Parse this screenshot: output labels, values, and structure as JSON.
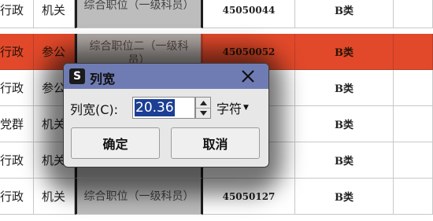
{
  "sheet": {
    "rows": [
      {
        "c1": "行政",
        "c2": "机关",
        "c3": "综合职位（一级科员）",
        "c4": "45050044",
        "c5": "B类",
        "selected": false
      },
      {
        "c1": "行政",
        "c2": "参公",
        "c3": "综合职位二（一级科员）",
        "c4": "45050052",
        "c5": "B类",
        "selected": true
      },
      {
        "c1": "行政",
        "c2": "参公",
        "c3": "",
        "c4": "",
        "c5": "B类",
        "selected": false
      },
      {
        "c1": "党群",
        "c2": "机关",
        "c3": "",
        "c4": "",
        "c5": "B类",
        "selected": false
      },
      {
        "c1": "行政",
        "c2": "机关",
        "c3": "",
        "c4": "",
        "c5": "B类",
        "selected": false
      },
      {
        "c1": "行政",
        "c2": "机关",
        "c3": "综合职位（一级科员）",
        "c4": "45050127",
        "c5": "B类",
        "selected": false
      }
    ]
  },
  "dialog": {
    "app_icon": "S",
    "title": "列宽",
    "label": "列宽(C):",
    "value": "20.36",
    "unit": "字符",
    "ok_label": "确定",
    "cancel_label": "取消",
    "icons": {
      "app": "wps-spreadsheet-icon",
      "close": "close-icon",
      "up": "spin-up-icon",
      "down": "spin-down-icon",
      "unit_dropdown": "chevron-down-icon"
    }
  },
  "colors": {
    "selected_row": "#e2492a",
    "titlebar": "#6f7cb4",
    "input_selection": "#1c3f94"
  }
}
